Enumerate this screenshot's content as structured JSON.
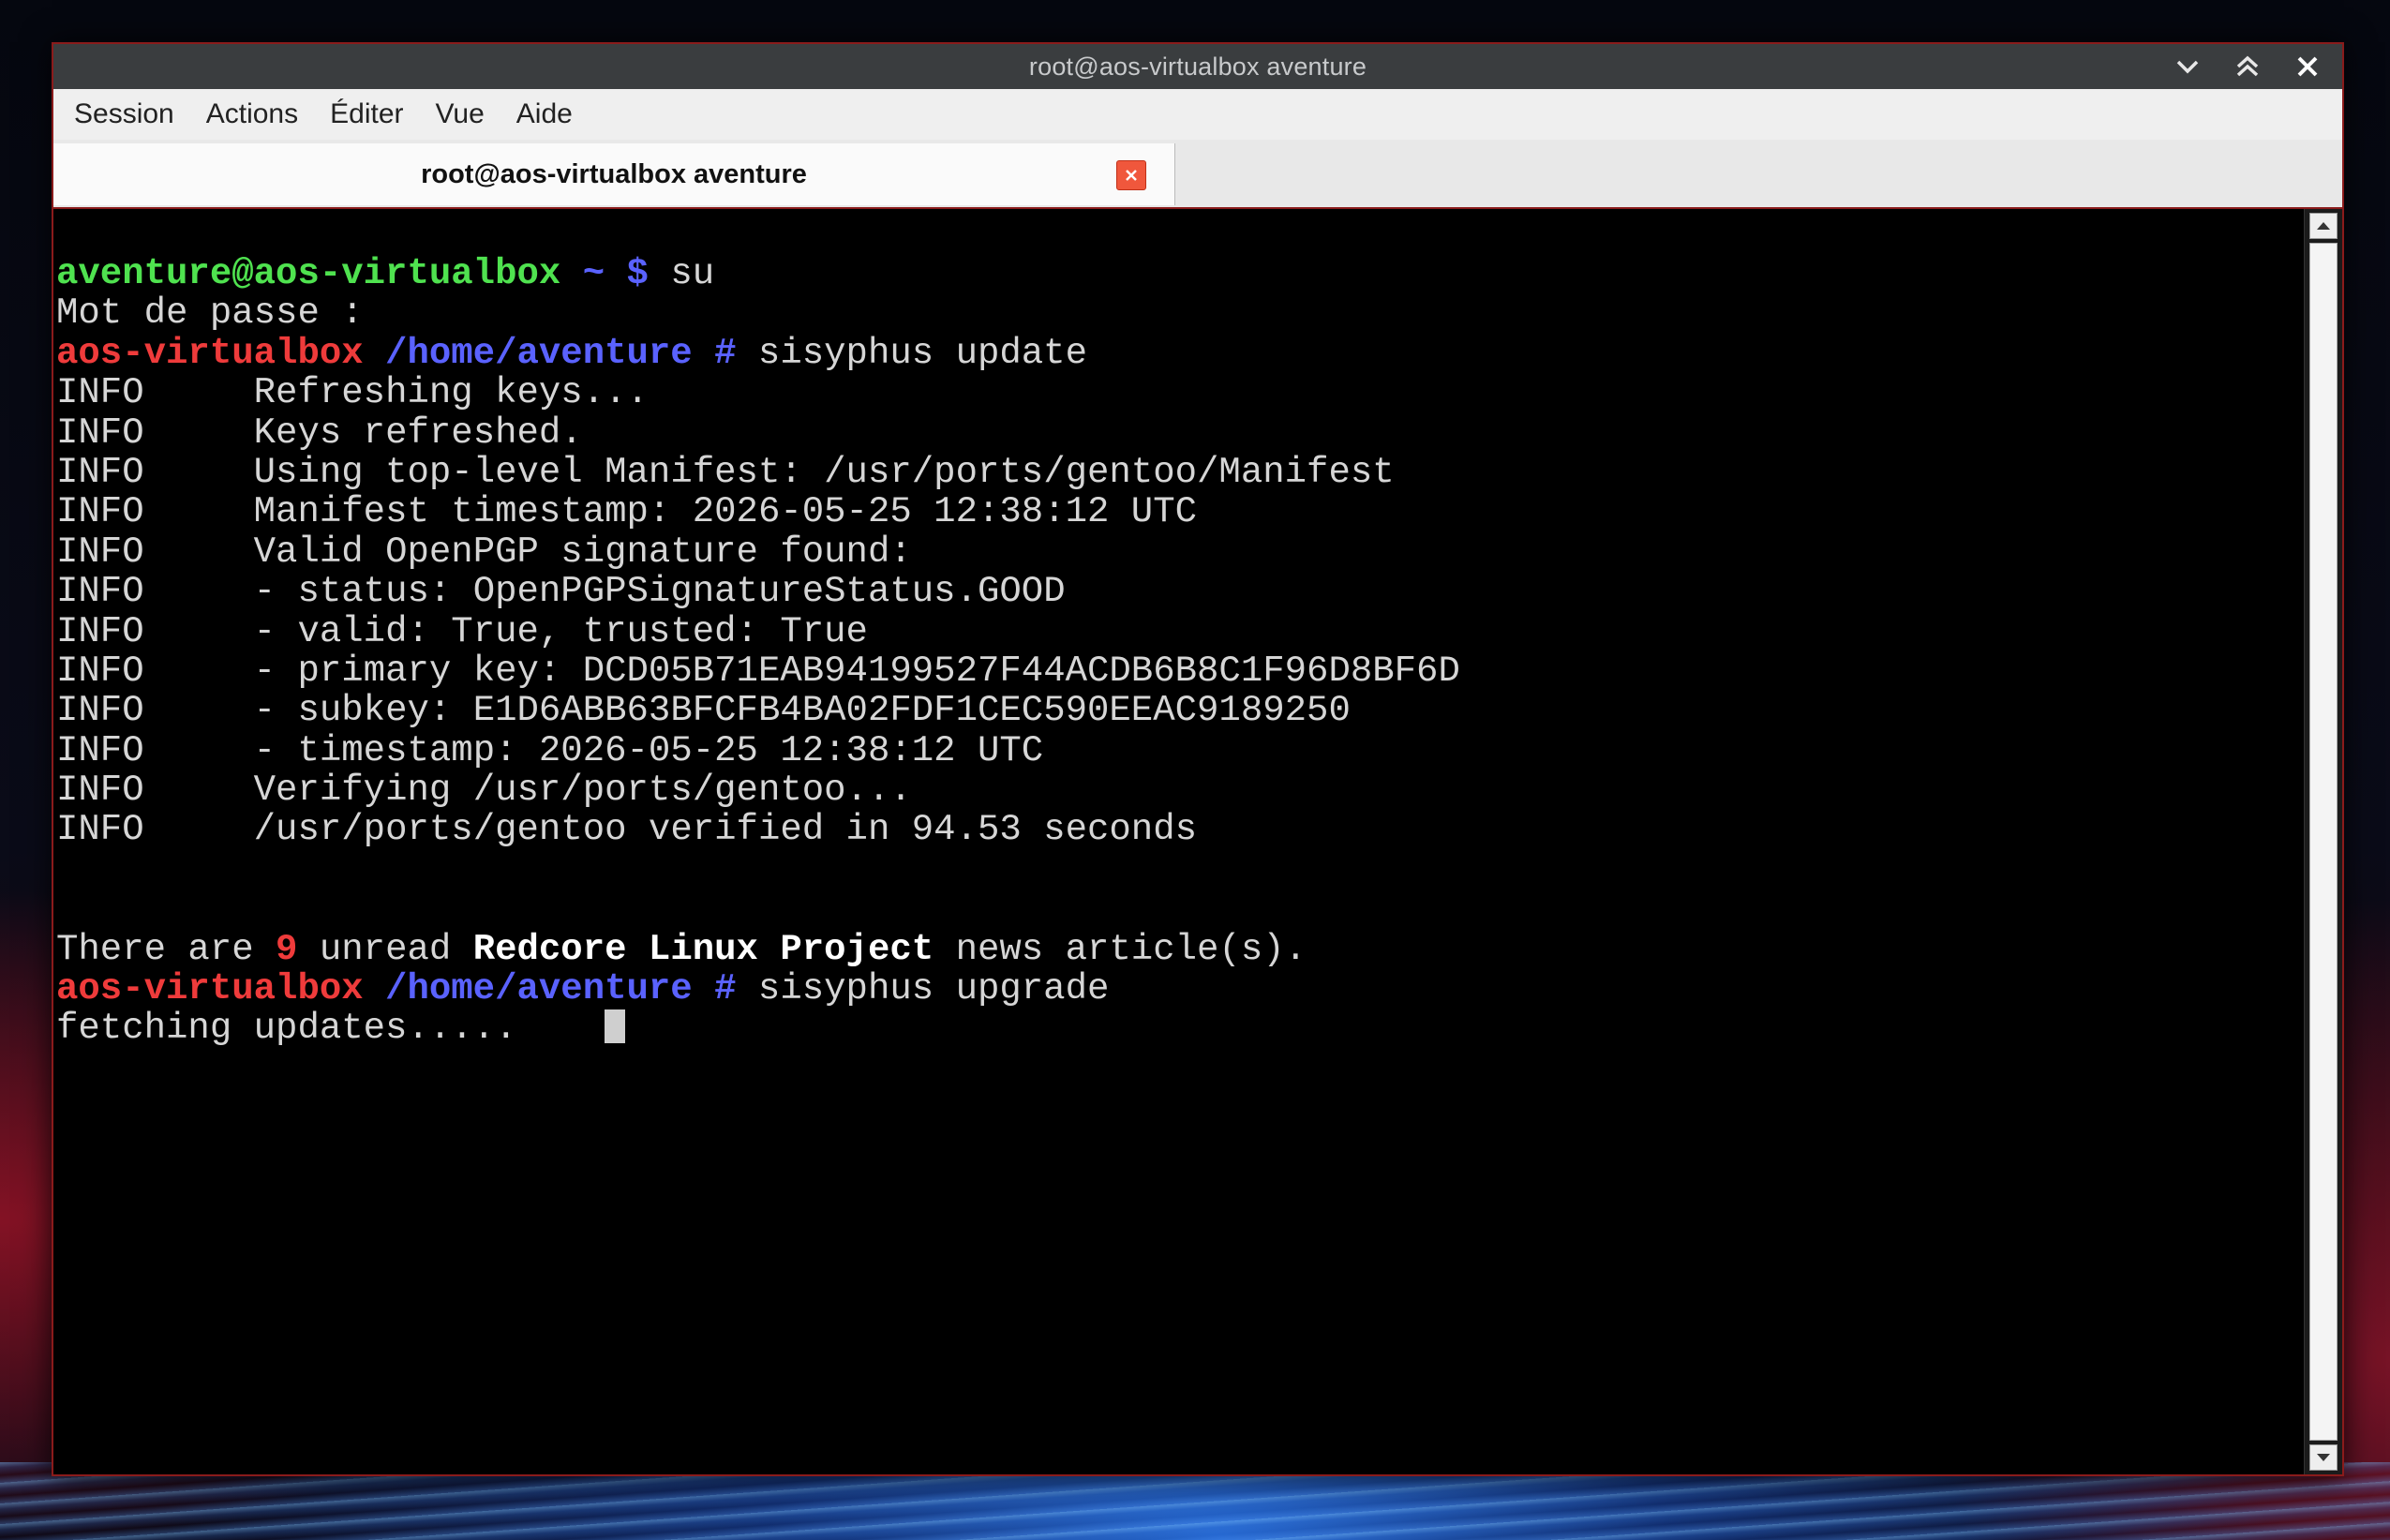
{
  "window": {
    "title": "root@aos-virtualbox aventure"
  },
  "menubar": {
    "items": [
      "Session",
      "Actions",
      "Éditer",
      "Vue",
      "Aide"
    ]
  },
  "tabs": [
    {
      "label": "root@aos-virtualbox aventure"
    }
  ],
  "colors": {
    "prompt_user_green": "#4fe24f",
    "prompt_host_red": "#ef3b3b",
    "prompt_path_blue": "#5a62ff",
    "window_border": "#8a1b1b"
  },
  "terminal": {
    "prompt1": {
      "userhost": "aventure@aos-virtualbox",
      "path": " ~ $",
      "command": " su"
    },
    "password_prompt": "Mot de passe :",
    "prompt2": {
      "host": "aos-virtualbox",
      "path": " /home/aventure #",
      "command": " sisyphus update"
    },
    "info_lines": [
      {
        "level": "INFO",
        "message": "Refreshing keys..."
      },
      {
        "level": "INFO",
        "message": "Keys refreshed."
      },
      {
        "level": "INFO",
        "message": "Using top-level Manifest: /usr/ports/gentoo/Manifest"
      },
      {
        "level": "INFO",
        "message": "Manifest timestamp: 2026-05-25 12:38:12 UTC"
      },
      {
        "level": "INFO",
        "message": "Valid OpenPGP signature found:"
      },
      {
        "level": "INFO",
        "message": "- status: OpenPGPSignatureStatus.GOOD"
      },
      {
        "level": "INFO",
        "message": "- valid: True, trusted: True"
      },
      {
        "level": "INFO",
        "message": "- primary key: DCD05B71EAB94199527F44ACDB6B8C1F96D8BF6D"
      },
      {
        "level": "INFO",
        "message": "- subkey: E1D6ABB63BFCFB4BA02FDF1CEC590EEAC9189250"
      },
      {
        "level": "INFO",
        "message": "- timestamp: 2026-05-25 12:38:12 UTC"
      },
      {
        "level": "INFO",
        "message": "Verifying /usr/ports/gentoo..."
      },
      {
        "level": "INFO",
        "message": "/usr/ports/gentoo verified in 94.53 seconds"
      }
    ],
    "news": {
      "prefix": "There are ",
      "count": "9",
      "mid": " unread ",
      "project": "Redcore Linux Project",
      "suffix": " news article(s)."
    },
    "prompt3": {
      "host": "aos-virtualbox",
      "path": " /home/aventure #",
      "command": " sisyphus upgrade"
    },
    "status_line": "fetching updates.....    "
  }
}
